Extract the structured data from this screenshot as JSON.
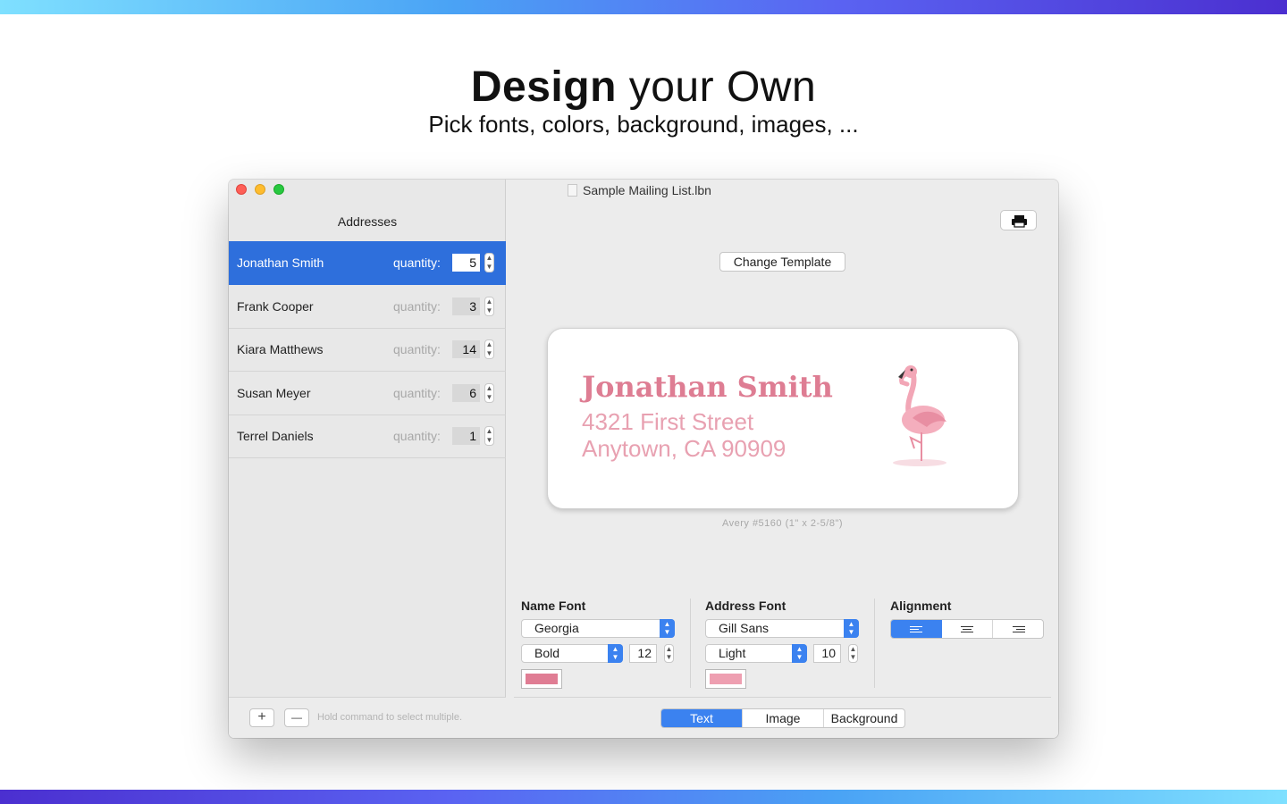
{
  "hero": {
    "title_bold": "Design",
    "title_rest": "your Own",
    "subtitle": "Pick fonts, colors, background, images, ..."
  },
  "window": {
    "doc_title": "Sample Mailing List.lbn"
  },
  "sidebar": {
    "title": "Addresses",
    "quantity_label": "quantity:",
    "rows": [
      {
        "name": "Jonathan Smith",
        "quantity": "5"
      },
      {
        "name": "Frank Cooper",
        "quantity": "3"
      },
      {
        "name": "Kiara Matthews",
        "quantity": "14"
      },
      {
        "name": "Susan Meyer",
        "quantity": "6"
      },
      {
        "name": "Terrel Daniels",
        "quantity": "1"
      }
    ],
    "add_label": "+",
    "remove_label": "—",
    "hint": "Hold command to select multiple."
  },
  "main": {
    "change_template": "Change Template",
    "label": {
      "name": "Jonathan Smith",
      "line1": "4321 First Street",
      "line2": "Anytown, CA 90909"
    },
    "avery": "Avery #5160 (1\" x 2-5/8\")",
    "name_font": {
      "title": "Name Font",
      "family": "Georgia",
      "style": "Bold",
      "size": "12",
      "color": "#e07d94"
    },
    "address_font": {
      "title": "Address Font",
      "family": "Gill Sans",
      "style": "Light",
      "size": "10",
      "color": "#ee9fb1"
    },
    "alignment": {
      "title": "Alignment",
      "selected": "left"
    },
    "tabs": [
      "Text",
      "Image",
      "Background"
    ],
    "active_tab": "Text"
  }
}
